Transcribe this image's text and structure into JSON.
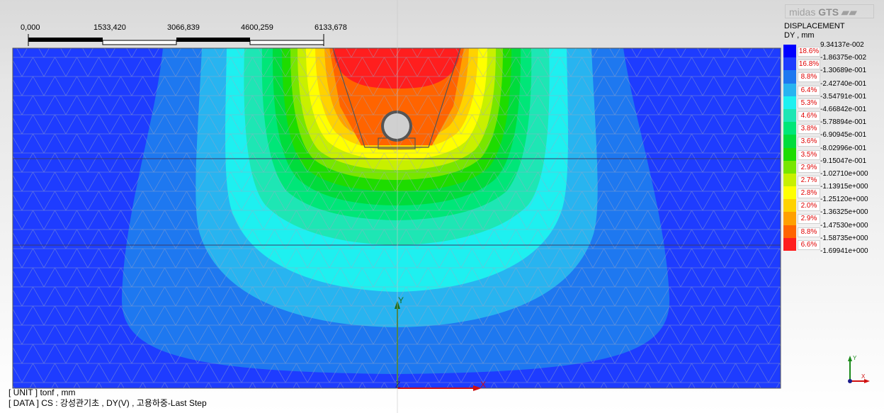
{
  "app": {
    "logo_text": "midas",
    "logo_bold": "GTS"
  },
  "scale_bar": {
    "labels": [
      "0,000",
      "1533,420",
      "3066,839",
      "4600,259",
      "6133,678"
    ]
  },
  "legend": {
    "title": "DISPLACEMENT",
    "subtitle": "DY , mm",
    "entries": [
      {
        "color": "#0000ff",
        "percent": "18.6%",
        "value": "9.34137e-002"
      },
      {
        "color": "#1e3cff",
        "percent": "16.8%",
        "value": "-1.86375e-002"
      },
      {
        "color": "#1e78f0",
        "percent": "8.8%",
        "value": "-1.30689e-001"
      },
      {
        "color": "#28b4f0",
        "percent": "6.4%",
        "value": "-2.42740e-001"
      },
      {
        "color": "#1ef0f0",
        "percent": "5.3%",
        "value": "-3.54791e-001"
      },
      {
        "color": "#1ee6b4",
        "percent": "4.6%",
        "value": "-4.66842e-001"
      },
      {
        "color": "#00e678",
        "percent": "3.8%",
        "value": "-5.78894e-001"
      },
      {
        "color": "#00dc3c",
        "percent": "3.6%",
        "value": "-6.90945e-001"
      },
      {
        "color": "#1edc00",
        "percent": "3.5%",
        "value": "-8.02996e-001"
      },
      {
        "color": "#78e600",
        "percent": "2.9%",
        "value": "-9.15047e-001"
      },
      {
        "color": "#c8f000",
        "percent": "2.7%",
        "value": "-1.02710e+000"
      },
      {
        "color": "#ffff00",
        "percent": "2.8%",
        "value": "-1.13915e+000"
      },
      {
        "color": "#ffd200",
        "percent": "2.0%",
        "value": "-1.25120e+000"
      },
      {
        "color": "#ffa000",
        "percent": "2.9%",
        "value": "-1.36325e+000"
      },
      {
        "color": "#ff6400",
        "percent": "8.8%",
        "value": "-1.47530e+000"
      },
      {
        "color": "#ff1e1e",
        "percent": "6.6%",
        "value": "-1.58735e+000"
      }
    ],
    "last_value": "-1.69941e+000"
  },
  "status": {
    "unit_line": "[ UNIT ]   tonf  ,  mm",
    "data_line": "[ DATA ]  CS : 강성관기초  ,   DY(V)  ,  고용하중-Last Step"
  },
  "axes": {
    "x_label": "X",
    "y_label": "Y",
    "z_label": "Z"
  }
}
